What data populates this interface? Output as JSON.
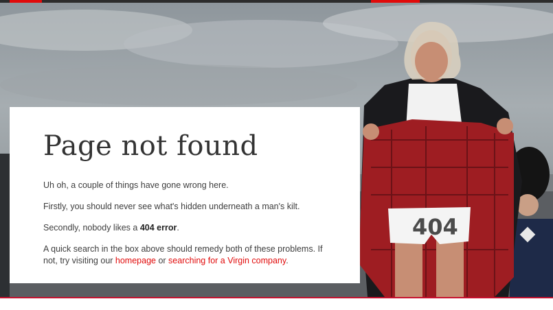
{
  "colors": {
    "accent": "#e10a0a",
    "top_bar": "#2c2c2c",
    "card_background": "#ffffff",
    "text": "#3d3d3d"
  },
  "hero": {
    "image_description_icon": "photo-icon",
    "shorts_number": "404"
  },
  "content": {
    "title": "Page not found",
    "line1": "Uh oh, a couple of things have gone wrong here.",
    "line2": "Firstly, you should never see what's hidden underneath a man's kilt.",
    "line3_prefix": "Secondly, nobody likes a ",
    "line3_bold": "404 error",
    "line3_suffix": ".",
    "line4_prefix": "A quick search in the box above should remedy both of these problems. If not, try visiting our ",
    "homepage_link": "homepage",
    "line4_mid": " or ",
    "search_link": "searching for a Virgin company",
    "line4_suffix": "."
  }
}
